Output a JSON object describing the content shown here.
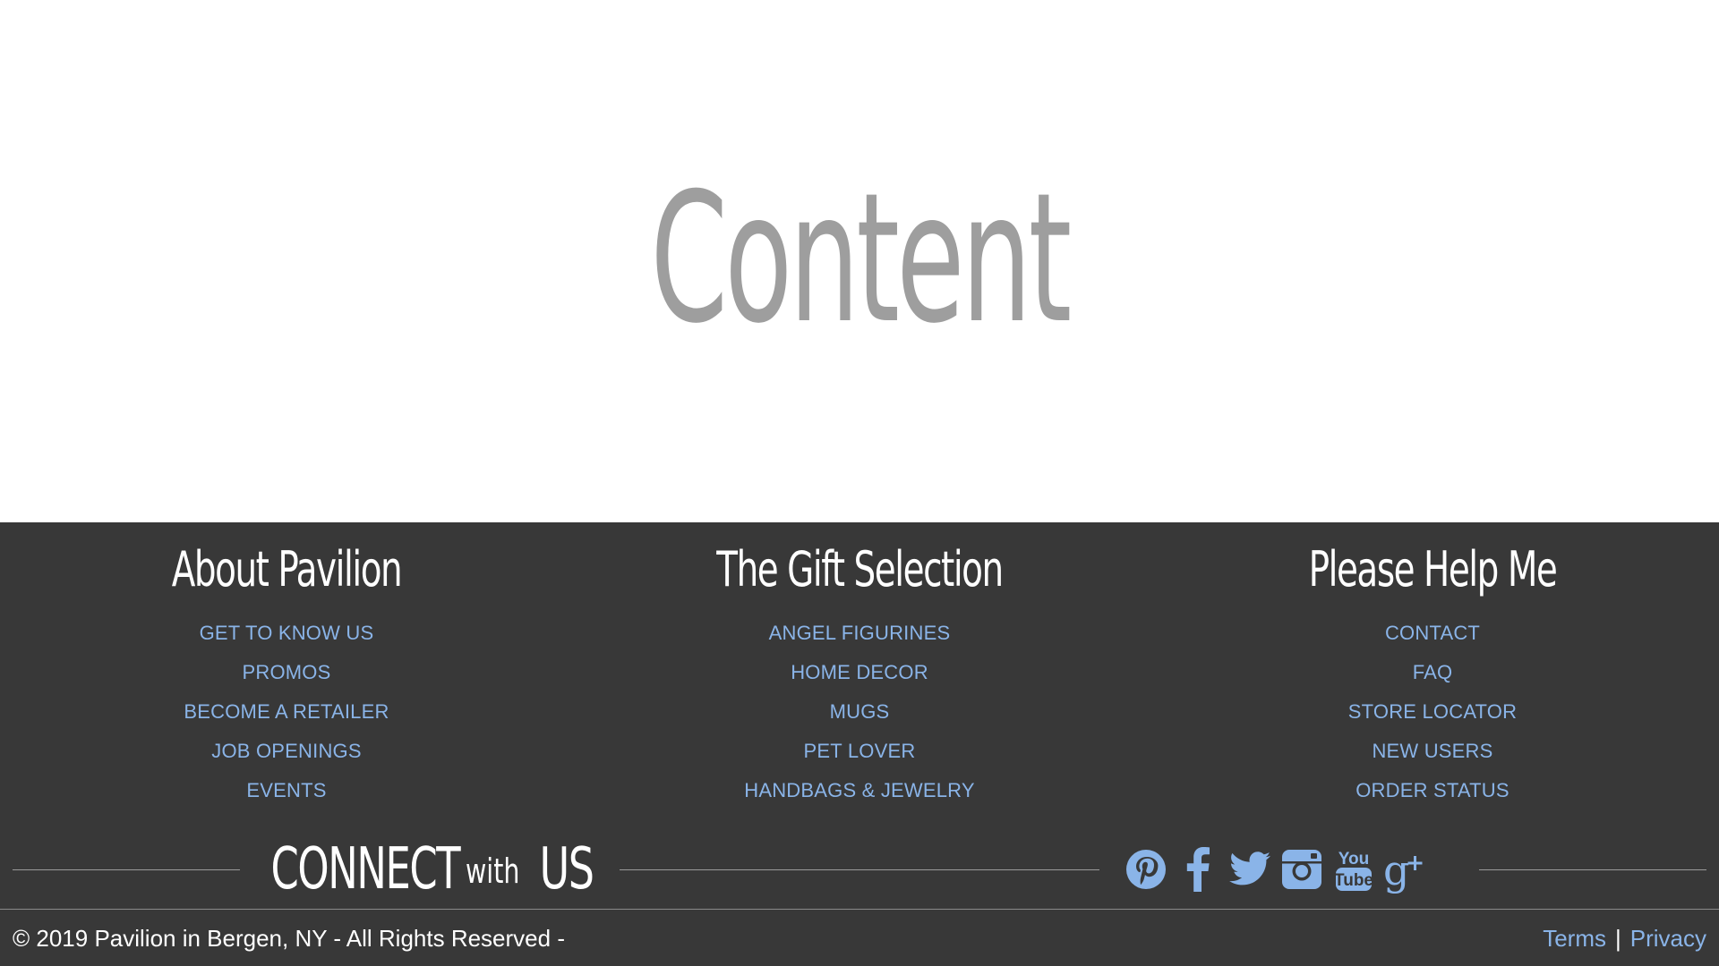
{
  "content": {
    "title": "Content"
  },
  "footer": {
    "columns": [
      {
        "heading": "About Pavilion",
        "links": [
          "GET TO KNOW US",
          "PROMOS",
          "BECOME A RETAILER",
          "JOB OPENINGS",
          "EVENTS"
        ]
      },
      {
        "heading": "The Gift Selection",
        "links": [
          "ANGEL FIGURINES",
          "HOME DECOR",
          "MUGS",
          "PET LOVER",
          "HANDBAGS & JEWELRY"
        ]
      },
      {
        "heading": "Please Help Me",
        "links": [
          "CONTACT",
          "FAQ",
          "STORE LOCATOR",
          "NEW USERS",
          "ORDER STATUS"
        ]
      }
    ],
    "connect": {
      "connect": "CONNECT",
      "with": "with",
      "us": "US"
    },
    "social_icons": [
      "pinterest-icon",
      "facebook-icon",
      "twitter-icon",
      "instagram-icon",
      "youtube-icon",
      "google-plus-icon"
    ],
    "copyright": "© 2019 Pavilion in Bergen, NY - All Rights Reserved -",
    "legal": {
      "terms": "Terms",
      "separator": "|",
      "privacy": "Privacy"
    }
  },
  "colors": {
    "footer_bg": "#383838",
    "link": "#8ab4e8",
    "content_text": "#9e9e9e",
    "heading_text": "#ffffff"
  }
}
